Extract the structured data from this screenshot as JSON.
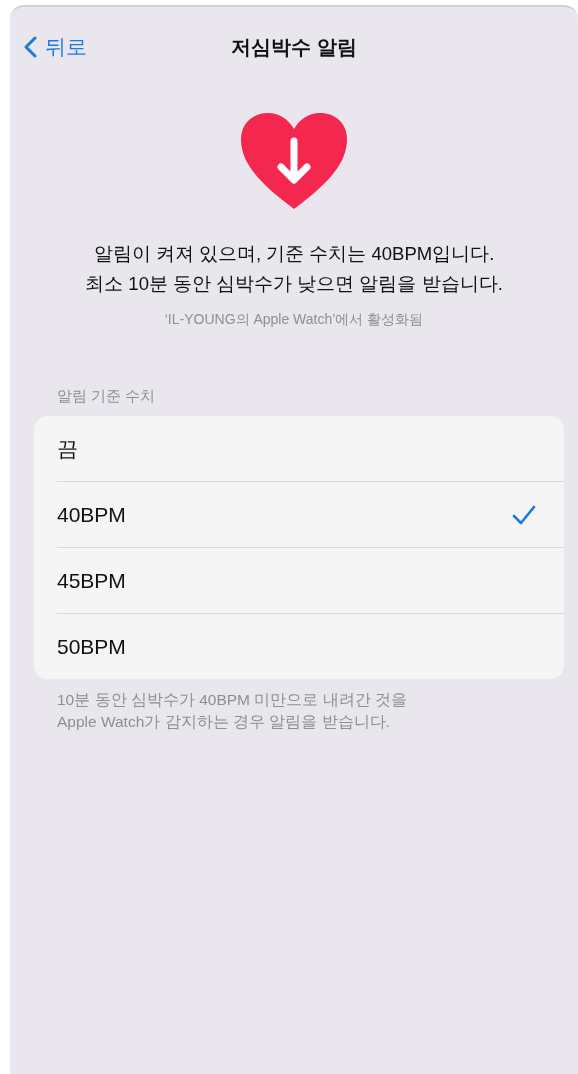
{
  "nav": {
    "back": "뒤로",
    "title": "저심박수 알림"
  },
  "summary": {
    "lines": [
      "알림이 켜져 있으며, 기준 수치는 40BPM입니다.",
      "최소 10분 동안 심박수가 낮으면 알림을 받습니다."
    ],
    "source": "‘IL-YOUNG의 Apple Watch’에서 활성화됨"
  },
  "section": {
    "header": "알림 기준 수치",
    "options": [
      {
        "label": "끔",
        "selected": false
      },
      {
        "label": "40BPM",
        "selected": true
      },
      {
        "label": "45BPM",
        "selected": false
      },
      {
        "label": "50BPM",
        "selected": false
      }
    ],
    "footer": [
      "10분 동안 심박수가 40BPM 미만으로 내려간 것을",
      "Apple Watch가 감지하는 경우 알림을 받습니다."
    ]
  }
}
